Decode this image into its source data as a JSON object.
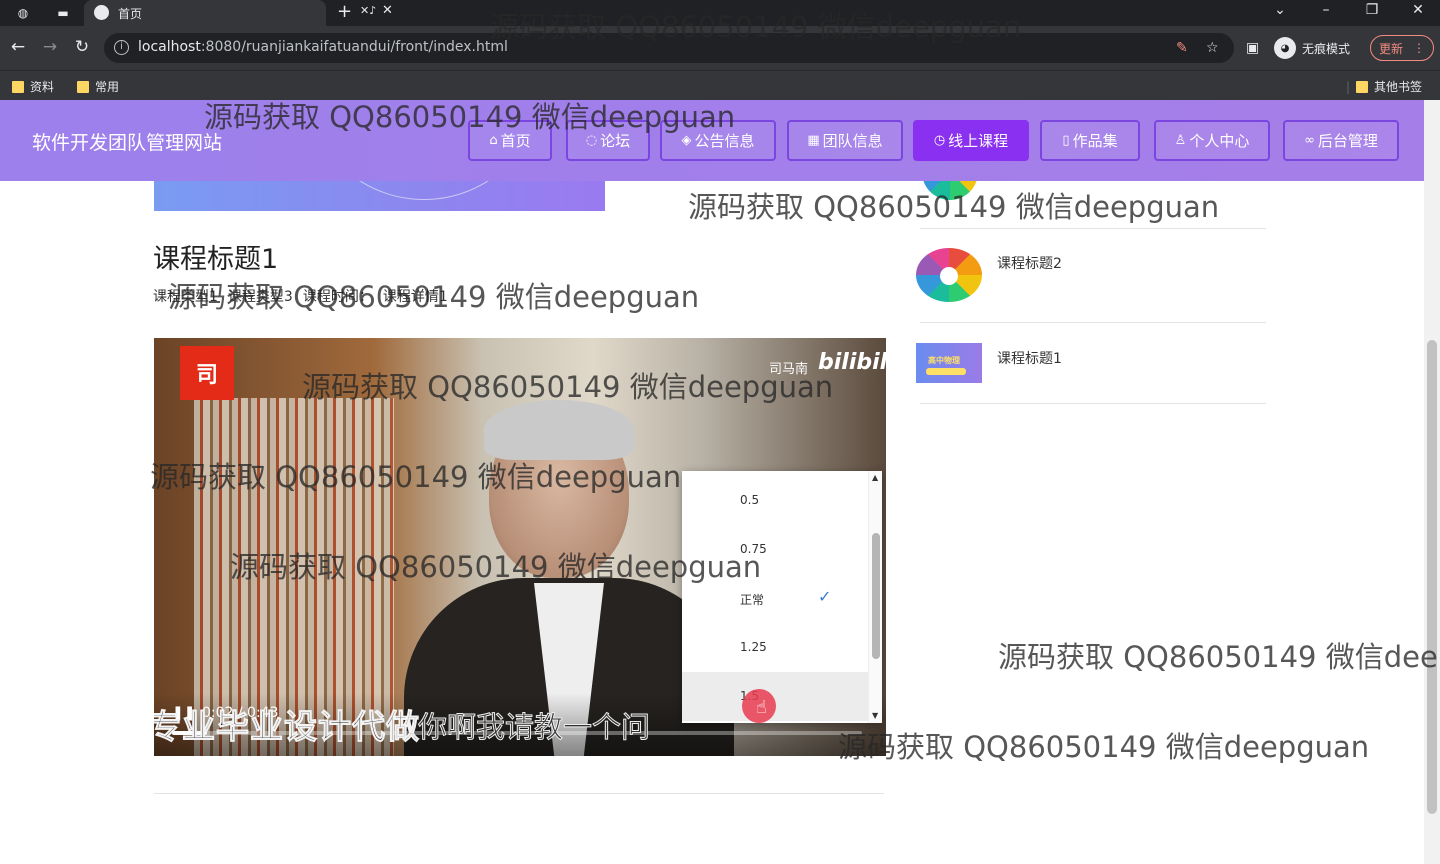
{
  "browser": {
    "tab_title": "首页",
    "url_host": "localhost",
    "url_rest": ":8080/ruanjiankaifatuandui/front/index.html",
    "incognito_label": "无痕模式",
    "update_label": "更新",
    "bookmarks": [
      "资料",
      "常用"
    ],
    "other_bookmarks": "其他书签"
  },
  "site": {
    "title": "软件开发团队管理网站",
    "nav": [
      {
        "label": "首页",
        "icon": "⌂"
      },
      {
        "label": "论坛",
        "icon": "◌"
      },
      {
        "label": "公告信息",
        "icon": "◈"
      },
      {
        "label": "团队信息",
        "icon": "▦"
      },
      {
        "label": "线上课程",
        "icon": "◷"
      },
      {
        "label": "作品集",
        "icon": "▯"
      },
      {
        "label": "个人中心",
        "icon": "♙"
      },
      {
        "label": "后台管理",
        "icon": "∞"
      }
    ],
    "active_nav": "线上课程"
  },
  "course": {
    "title": "课程标题1",
    "meta": [
      "课程类型1",
      "课程类型3",
      "课程时间：",
      "课程详情1"
    ]
  },
  "video": {
    "logo_char": "司",
    "channel": "司马南",
    "brand": "bilibili",
    "time": "0:02 / 0:43",
    "progress": 0.05,
    "subtitle": "专业毕业设计代做",
    "subtitle2": "你啊我请教一个问",
    "speed_options": [
      "0.5",
      "0.75",
      "正常",
      "1.25",
      "1.5"
    ],
    "selected_speed": "正常",
    "hover_speed": "1.5"
  },
  "side_courses": [
    {
      "title": "课程标题2"
    },
    {
      "title": "课程标题1"
    }
  ],
  "watermark": {
    "text": "源码获取 QQ86050149 微信deepguan",
    "text_cut": "源码获取 QQ86050149 微信dee"
  },
  "colors": {
    "header_bg": "#9d80ec",
    "nav_active": "#8a30f0",
    "nav_border": "#7b45e0"
  }
}
